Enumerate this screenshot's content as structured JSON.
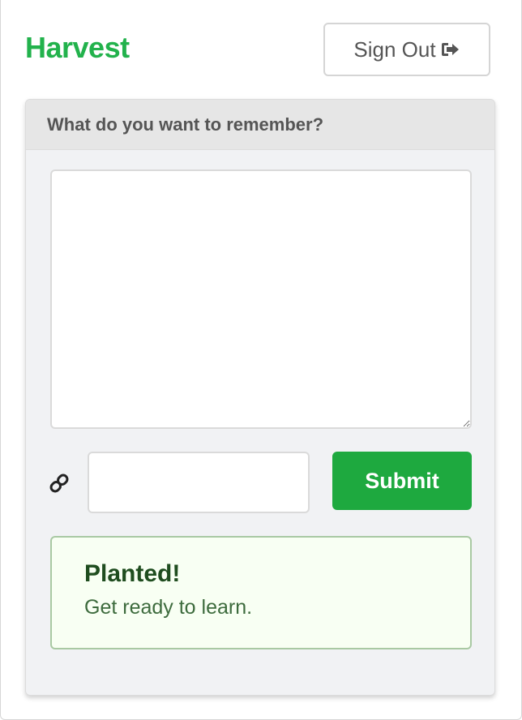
{
  "app": {
    "title": "Harvest"
  },
  "header": {
    "sign_out_label": "Sign Out",
    "sign_out_icon": "sign-out-icon"
  },
  "panel": {
    "heading": "What do you want to remember?",
    "memo": {
      "value": "",
      "placeholder": ""
    },
    "link": {
      "icon": "link-icon",
      "value": "",
      "placeholder": ""
    },
    "submit_label": "Submit"
  },
  "alert": {
    "title": "Planted!",
    "message": "Get ready to learn."
  },
  "colors": {
    "brand": "#22b24c",
    "submit": "#1ea93f",
    "alert_border": "#a9c9a3",
    "alert_bg": "#f8fff3"
  }
}
